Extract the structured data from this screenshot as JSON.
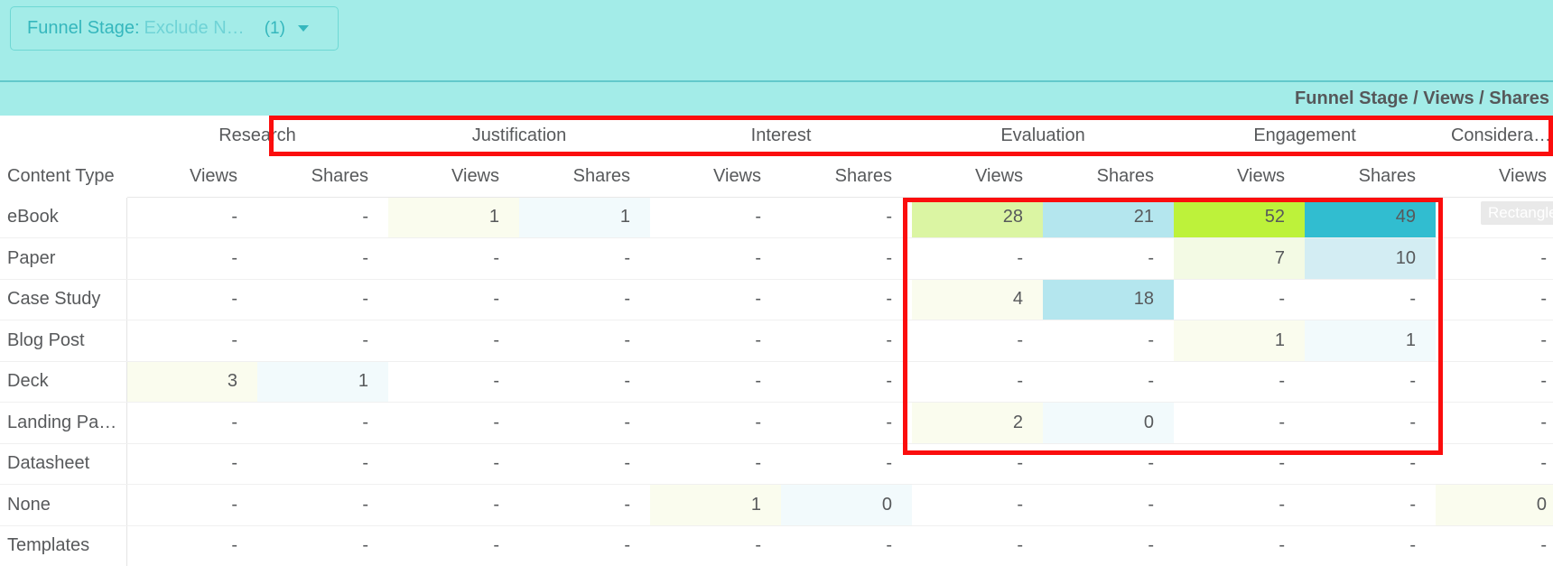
{
  "filter": {
    "label": "Funnel Stage:",
    "value": "Exclude N…",
    "count": "(1)",
    "caret": "chevron-down-icon"
  },
  "title": "Funnel Stage / Views / Shares",
  "tooltip": "Rectangle",
  "colors": {
    "teal_bg": "#a3ece8",
    "chip_text": "#35b7bd",
    "annotation": "#fb0d0d",
    "green_high": "#bdf23a",
    "green_mid": "#dbf5a3",
    "green_low": "#f3fae4",
    "green_faint": "#fafcee",
    "blue_high": "#31bdd0",
    "blue_mid": "#b4e6ee",
    "blue_low": "#d3edf3",
    "blue_faint": "#f2fafc"
  },
  "table": {
    "label_header": "Content Type",
    "groups": [
      {
        "name": "",
        "span": 1
      },
      {
        "name": "Research",
        "span": 2
      },
      {
        "name": "Justification",
        "span": 2
      },
      {
        "name": "Interest",
        "span": 2
      },
      {
        "name": "Evaluation",
        "span": 2
      },
      {
        "name": "Engagement",
        "span": 2
      },
      {
        "name": "Considera…",
        "span": 1
      }
    ],
    "sub_headers": [
      "Views",
      "Shares",
      "Views",
      "Shares",
      "Views",
      "Shares",
      "Views",
      "Shares",
      "Views",
      "Shares",
      "Views"
    ],
    "rows": [
      {
        "label": "eBook",
        "cells": [
          {
            "v": "-",
            "bg": "none"
          },
          {
            "v": "-",
            "bg": "none"
          },
          {
            "v": "1",
            "bg": "green_faint"
          },
          {
            "v": "1",
            "bg": "blue_faint"
          },
          {
            "v": "-",
            "bg": "none"
          },
          {
            "v": "-",
            "bg": "none"
          },
          {
            "v": "28",
            "bg": "green_mid"
          },
          {
            "v": "21",
            "bg": "blue_mid"
          },
          {
            "v": "52",
            "bg": "green_high"
          },
          {
            "v": "49",
            "bg": "blue_high"
          },
          {
            "v": "-",
            "bg": "none"
          }
        ]
      },
      {
        "label": "Paper",
        "cells": [
          {
            "v": "-",
            "bg": "none"
          },
          {
            "v": "-",
            "bg": "none"
          },
          {
            "v": "-",
            "bg": "none"
          },
          {
            "v": "-",
            "bg": "none"
          },
          {
            "v": "-",
            "bg": "none"
          },
          {
            "v": "-",
            "bg": "none"
          },
          {
            "v": "-",
            "bg": "none"
          },
          {
            "v": "-",
            "bg": "none"
          },
          {
            "v": "7",
            "bg": "green_low"
          },
          {
            "v": "10",
            "bg": "blue_low"
          },
          {
            "v": "-",
            "bg": "none"
          }
        ]
      },
      {
        "label": "Case Study",
        "cells": [
          {
            "v": "-",
            "bg": "none"
          },
          {
            "v": "-",
            "bg": "none"
          },
          {
            "v": "-",
            "bg": "none"
          },
          {
            "v": "-",
            "bg": "none"
          },
          {
            "v": "-",
            "bg": "none"
          },
          {
            "v": "-",
            "bg": "none"
          },
          {
            "v": "4",
            "bg": "green_faint"
          },
          {
            "v": "18",
            "bg": "blue_mid"
          },
          {
            "v": "-",
            "bg": "none"
          },
          {
            "v": "-",
            "bg": "none"
          },
          {
            "v": "-",
            "bg": "none"
          }
        ]
      },
      {
        "label": "Blog Post",
        "cells": [
          {
            "v": "-",
            "bg": "none"
          },
          {
            "v": "-",
            "bg": "none"
          },
          {
            "v": "-",
            "bg": "none"
          },
          {
            "v": "-",
            "bg": "none"
          },
          {
            "v": "-",
            "bg": "none"
          },
          {
            "v": "-",
            "bg": "none"
          },
          {
            "v": "-",
            "bg": "none"
          },
          {
            "v": "-",
            "bg": "none"
          },
          {
            "v": "1",
            "bg": "green_faint"
          },
          {
            "v": "1",
            "bg": "blue_faint"
          },
          {
            "v": "-",
            "bg": "none"
          }
        ]
      },
      {
        "label": "Deck",
        "cells": [
          {
            "v": "3",
            "bg": "green_faint"
          },
          {
            "v": "1",
            "bg": "blue_faint"
          },
          {
            "v": "-",
            "bg": "none"
          },
          {
            "v": "-",
            "bg": "none"
          },
          {
            "v": "-",
            "bg": "none"
          },
          {
            "v": "-",
            "bg": "none"
          },
          {
            "v": "-",
            "bg": "none"
          },
          {
            "v": "-",
            "bg": "none"
          },
          {
            "v": "-",
            "bg": "none"
          },
          {
            "v": "-",
            "bg": "none"
          },
          {
            "v": "-",
            "bg": "none"
          }
        ]
      },
      {
        "label": "Landing Pa…",
        "cells": [
          {
            "v": "-",
            "bg": "none"
          },
          {
            "v": "-",
            "bg": "none"
          },
          {
            "v": "-",
            "bg": "none"
          },
          {
            "v": "-",
            "bg": "none"
          },
          {
            "v": "-",
            "bg": "none"
          },
          {
            "v": "-",
            "bg": "none"
          },
          {
            "v": "2",
            "bg": "green_faint"
          },
          {
            "v": "0",
            "bg": "blue_faint"
          },
          {
            "v": "-",
            "bg": "none"
          },
          {
            "v": "-",
            "bg": "none"
          },
          {
            "v": "-",
            "bg": "none"
          }
        ]
      },
      {
        "label": "Datasheet",
        "cells": [
          {
            "v": "-",
            "bg": "none"
          },
          {
            "v": "-",
            "bg": "none"
          },
          {
            "v": "-",
            "bg": "none"
          },
          {
            "v": "-",
            "bg": "none"
          },
          {
            "v": "-",
            "bg": "none"
          },
          {
            "v": "-",
            "bg": "none"
          },
          {
            "v": "-",
            "bg": "none"
          },
          {
            "v": "-",
            "bg": "none"
          },
          {
            "v": "-",
            "bg": "none"
          },
          {
            "v": "-",
            "bg": "none"
          },
          {
            "v": "-",
            "bg": "none"
          }
        ]
      },
      {
        "label": "None",
        "cells": [
          {
            "v": "-",
            "bg": "none"
          },
          {
            "v": "-",
            "bg": "none"
          },
          {
            "v": "-",
            "bg": "none"
          },
          {
            "v": "-",
            "bg": "none"
          },
          {
            "v": "1",
            "bg": "green_faint"
          },
          {
            "v": "0",
            "bg": "blue_faint"
          },
          {
            "v": "-",
            "bg": "none"
          },
          {
            "v": "-",
            "bg": "none"
          },
          {
            "v": "-",
            "bg": "none"
          },
          {
            "v": "-",
            "bg": "none"
          },
          {
            "v": "0",
            "bg": "green_faint"
          }
        ]
      },
      {
        "label": "Templates",
        "cells": [
          {
            "v": "-",
            "bg": "none"
          },
          {
            "v": "-",
            "bg": "none"
          },
          {
            "v": "-",
            "bg": "none"
          },
          {
            "v": "-",
            "bg": "none"
          },
          {
            "v": "-",
            "bg": "none"
          },
          {
            "v": "-",
            "bg": "none"
          },
          {
            "v": "-",
            "bg": "none"
          },
          {
            "v": "-",
            "bg": "none"
          },
          {
            "v": "-",
            "bg": "none"
          },
          {
            "v": "-",
            "bg": "none"
          },
          {
            "v": "-",
            "bg": "none"
          }
        ]
      }
    ]
  }
}
